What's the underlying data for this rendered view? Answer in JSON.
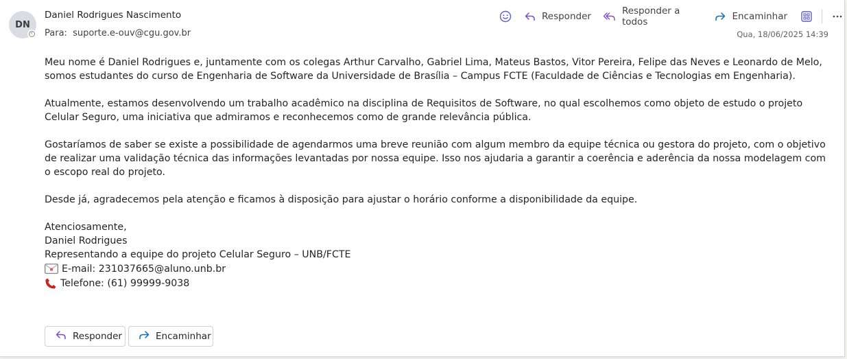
{
  "sender": {
    "initials": "DN",
    "name": "Daniel Rodrigues Nascimento"
  },
  "recipient": {
    "label": "Para:",
    "address": "suporte.e-ouv@cgu.gov.br"
  },
  "date": "Qua, 18/06/2025 14:39",
  "toolbar": {
    "reply": "Responder",
    "reply_all": "Responder a todos",
    "forward": "Encaminhar",
    "icons": [
      "emoji-icon",
      "reply-icon",
      "reply-all-icon",
      "forward-icon",
      "apps-icon",
      "more-icon"
    ]
  },
  "body": {
    "paragraphs": [
      "Meu nome é Daniel Rodrigues e, juntamente com os colegas Arthur Carvalho, Gabriel Lima, Mateus Bastos, Vitor Pereira, Felipe das Neves e Leonardo de Melo, somos estudantes do curso de Engenharia de Software da Universidade de Brasília – Campus FCTE (Faculdade de Ciências e Tecnologias em Engenharia).",
      "Atualmente, estamos desenvolvendo um trabalho acadêmico na disciplina de Requisitos de Software, no qual escolhemos como objeto de estudo o projeto Celular Seguro, uma iniciativa que admiramos e reconhecemos como de grande relevância pública.",
      "Gostaríamos de saber se existe a possibilidade de agendarmos uma breve reunião com algum membro da equipe técnica ou gestora do projeto, com o objetivo de realizar uma validação técnica das informações levantadas por nossa equipe. Isso nos ajudaria a garantir a coerência e aderência da nossa modelagem com o escopo real do projeto.",
      "Desde já, agradecemos pela atenção e ficamos à disposição para ajustar o horário conforme a disponibilidade da equipe."
    ],
    "signature": {
      "closing": "Atenciosamente,",
      "name": "Daniel Rodrigues",
      "role": "Representando a equipe do projeto Celular Seguro – UNB/FCTE",
      "email": "E-mail: 231037665@aluno.unb.br",
      "phone": "Telefone: (61) 99999-9038"
    }
  },
  "actions": {
    "reply": "Responder",
    "forward": "Encaminhar"
  },
  "colors": {
    "accent": "#5b5fc7",
    "forward_blue": "#0f6cbd",
    "reply_purple": "#7b4dc9"
  }
}
